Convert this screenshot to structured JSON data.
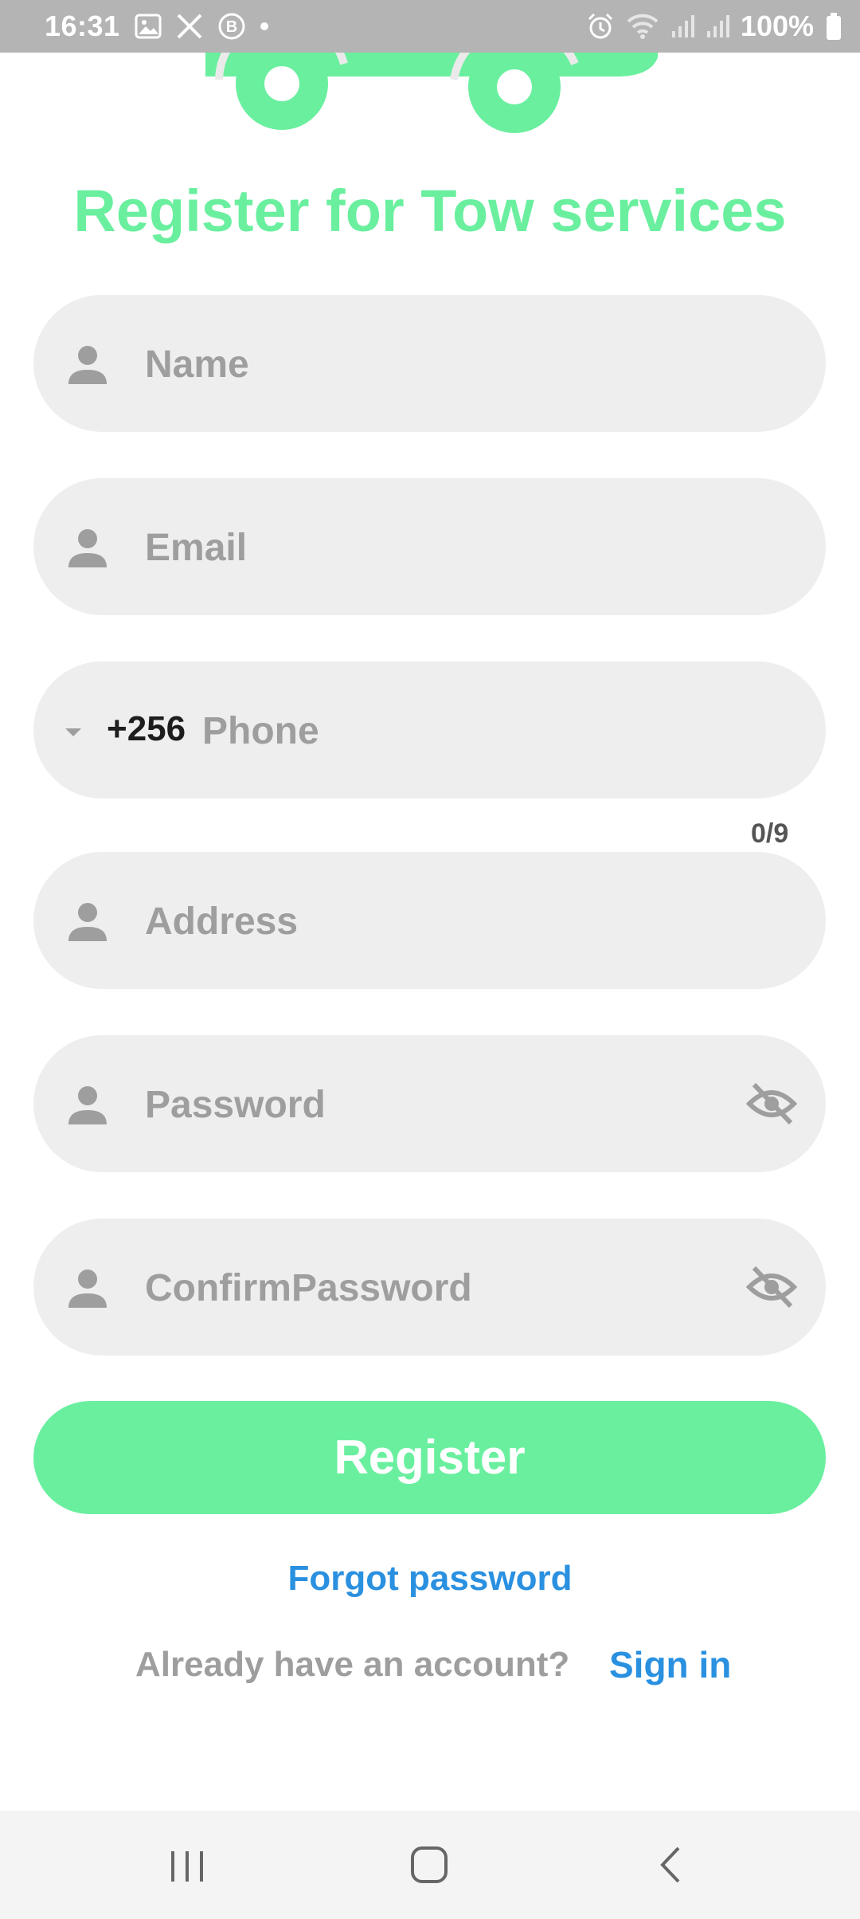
{
  "status_bar": {
    "time": "16:31",
    "battery": "100%",
    "icons": [
      "image-icon",
      "x-icon",
      "b-icon",
      "alarm-icon",
      "wifi-icon",
      "signal-icon",
      "signal-icon",
      "battery-icon"
    ]
  },
  "colors": {
    "accent_green": "#6aef9f",
    "link_blue": "#2a90e0",
    "field_bg": "#eeeeee",
    "placeholder": "#9e9e9e"
  },
  "title": "Register for Tow services",
  "fields": {
    "name": {
      "placeholder": "Name",
      "value": ""
    },
    "email": {
      "placeholder": "Email",
      "value": ""
    },
    "phone": {
      "country_code": "+256",
      "placeholder": "Phone",
      "value": "",
      "counter": "0/9"
    },
    "address": {
      "placeholder": "Address",
      "value": ""
    },
    "password": {
      "placeholder": "Password",
      "value": ""
    },
    "confirm_password": {
      "placeholder": "ConfirmPassword",
      "value": ""
    }
  },
  "register_label": "Register",
  "forgot_label": "Forgot password",
  "already_text": "Already have an account?",
  "signin_label": "Sign in"
}
